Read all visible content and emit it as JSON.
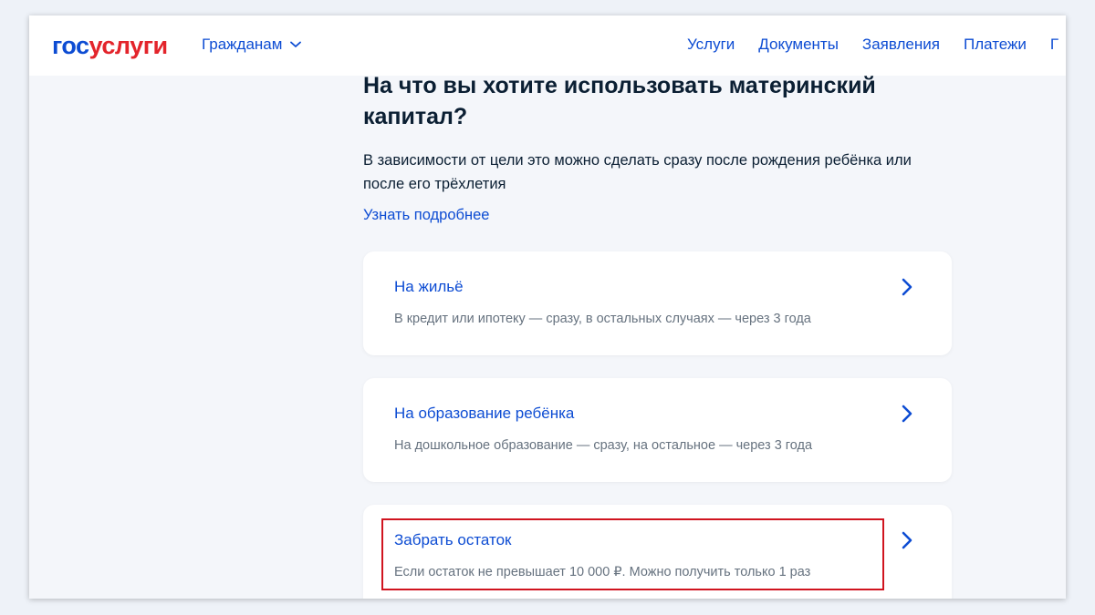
{
  "header": {
    "logo": {
      "part1": "гос",
      "part2": "услуги"
    },
    "citizens_label": "Гражданам",
    "nav": [
      "Услуги",
      "Документы",
      "Заявления",
      "Платежи",
      "Г"
    ]
  },
  "page": {
    "title": "На что вы хотите использовать материнский капитал?",
    "description": "В зависимости от цели это можно сделать сразу после рождения ребёнка или после его трёхлетия",
    "more_link": "Узнать подробнее"
  },
  "cards": [
    {
      "title": "На жильё",
      "subtitle": "В кредит или ипотеку — сразу, в остальных случаях — через 3 года"
    },
    {
      "title": "На образование ребёнка",
      "subtitle": "На дошкольное образование — сразу, на остальное — через 3 года"
    },
    {
      "title": "Забрать остаток",
      "subtitle": "Если остаток не превышает 10 000 ₽. Можно получить только 1 раз"
    }
  ],
  "colors": {
    "link": "#0d4cd3",
    "logo_red": "#e3242b",
    "text": "#0b1f33",
    "muted": "#66727f",
    "highlight": "#d0141f"
  },
  "icons": {
    "citizens_dropdown": "chevron-down-icon",
    "card_arrow": "chevron-right-icon"
  }
}
